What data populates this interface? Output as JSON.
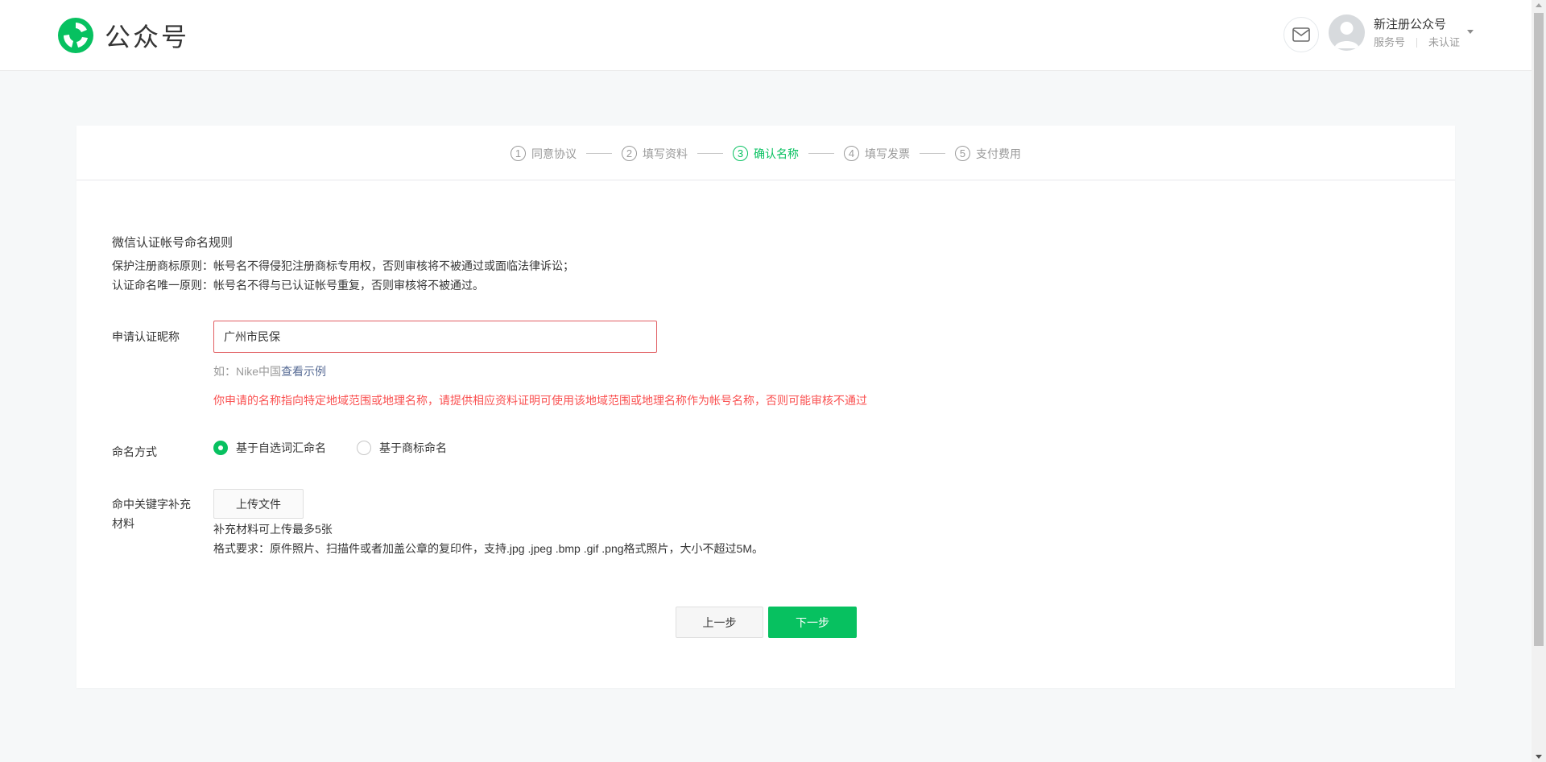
{
  "header": {
    "logo_text": "公众号",
    "account_name": "新注册公众号",
    "account_type": "服务号",
    "account_status": "未认证",
    "icons": {
      "logo": "wechat-official-account-logo",
      "mail": "mail-icon",
      "avatar": "avatar-placeholder",
      "dropdown": "caret-down-icon"
    }
  },
  "steps": [
    {
      "num": "1",
      "label": "同意协议",
      "active": false
    },
    {
      "num": "2",
      "label": "填写资料",
      "active": false
    },
    {
      "num": "3",
      "label": "确认名称",
      "active": true
    },
    {
      "num": "4",
      "label": "填写发票",
      "active": false
    },
    {
      "num": "5",
      "label": "支付费用",
      "active": false
    }
  ],
  "rules": {
    "title": "微信认证帐号命名规则",
    "line1": "保护注册商标原则：帐号名不得侵犯注册商标专用权，否则审核将不被通过或面临法律诉讼；",
    "line2": "认证命名唯一原则：帐号名不得与已认证帐号重复，否则审核将不被通过。"
  },
  "form": {
    "nickname_label": "申请认证昵称",
    "nickname_value": "广州市民保",
    "hint_prefix": "如：Nike中国",
    "hint_link": "查看示例",
    "error_text": "你申请的名称指向特定地域范围或地理名称，请提供相应资料证明可使用该地域范围或地理名称作为帐号名称，否则可能审核不通过",
    "mode_label": "命名方式",
    "mode_options": [
      {
        "label": "基于自选词汇命名",
        "checked": true
      },
      {
        "label": "基于商标命名",
        "checked": false
      }
    ],
    "material_label": "命中关键字补充材料",
    "upload_label": "上传文件",
    "material_note1": "补充材料可上传最多5张",
    "material_note2": "格式要求：原件照片、扫描件或者加盖公章的复印件，支持.jpg .jpeg .bmp .gif .png格式照片，大小不超过5M。"
  },
  "actions": {
    "prev_label": "上一步",
    "next_label": "下一步"
  },
  "colors": {
    "brand_green": "#07c160",
    "error_red": "#fa5151",
    "link_blue": "#576b95"
  }
}
